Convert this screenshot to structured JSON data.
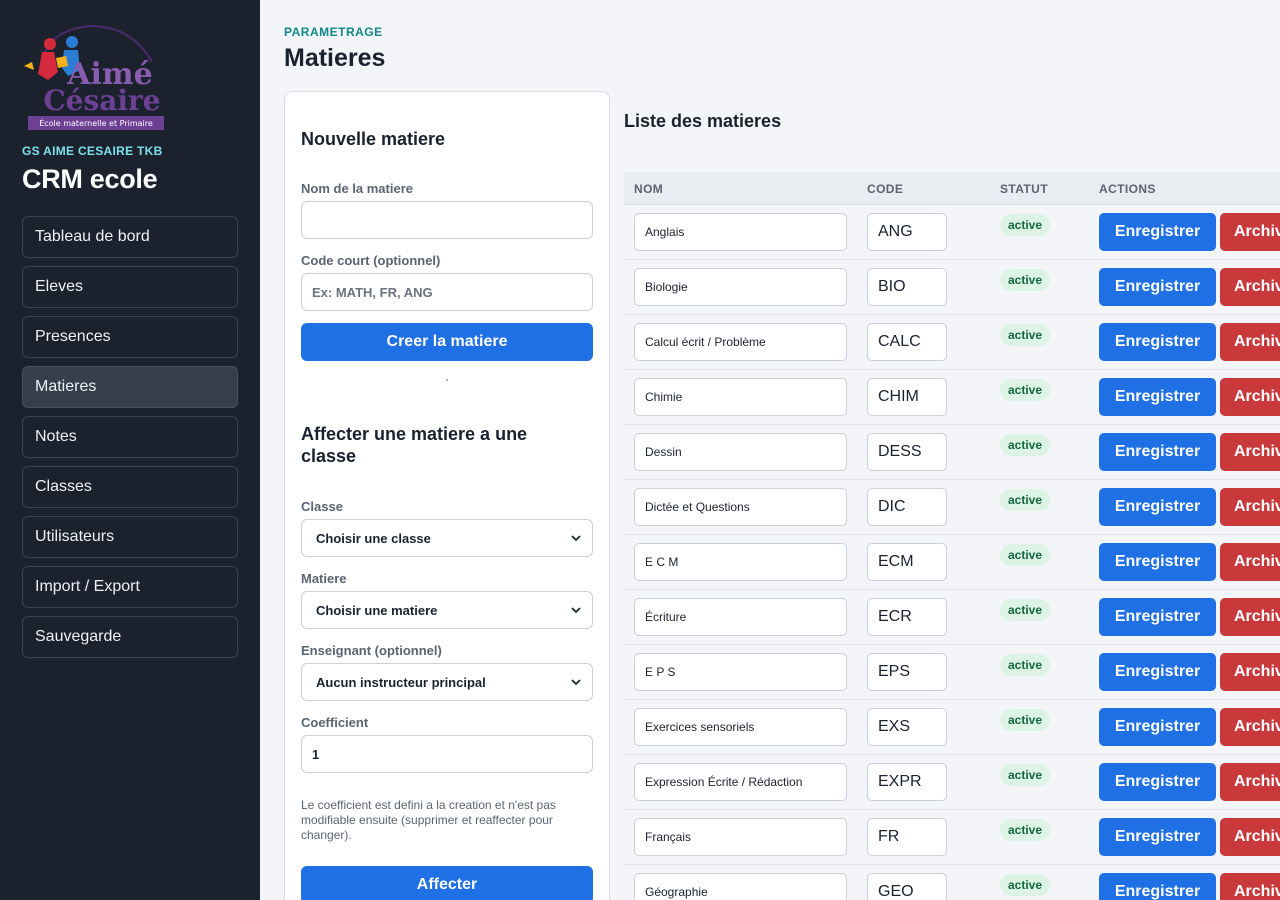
{
  "sidebar": {
    "logo_text": "Aimé Césaire",
    "logo_subtitle": "École maternelle et Primaire",
    "org": "GS AIME CESAIRE TKB",
    "app_title": "CRM ecole",
    "items": [
      {
        "label": "Tableau de bord",
        "active": false
      },
      {
        "label": "Eleves",
        "active": false
      },
      {
        "label": "Presences",
        "active": false
      },
      {
        "label": "Matieres",
        "active": true
      },
      {
        "label": "Notes",
        "active": false
      },
      {
        "label": "Classes",
        "active": false
      },
      {
        "label": "Utilisateurs",
        "active": false
      },
      {
        "label": "Import / Export",
        "active": false
      },
      {
        "label": "Sauvegarde",
        "active": false
      }
    ]
  },
  "header": {
    "eyebrow": "PARAMETRAGE",
    "title": "Matieres"
  },
  "create_form": {
    "title": "Nouvelle matiere",
    "name_label": "Nom de la matiere",
    "name_value": "",
    "code_label": "Code court (optionnel)",
    "code_placeholder": "Ex: MATH, FR, ANG",
    "submit_label": "Creer la matiere"
  },
  "assign_form": {
    "title": "Affecter une matiere a une classe",
    "class_label": "Classe",
    "class_value": "Choisir une classe",
    "subject_label": "Matiere",
    "subject_value": "Choisir une matiere",
    "teacher_label": "Enseignant (optionnel)",
    "teacher_value": "Aucun instructeur principal",
    "coef_label": "Coefficient",
    "coef_value": "1",
    "hint": "Le coefficient est defini a la creation et n'est pas modifiable ensuite (supprimer et reaffecter pour changer).",
    "submit_label": "Affecter"
  },
  "list": {
    "title": "Liste des matieres",
    "columns": {
      "name": "NOM",
      "code": "CODE",
      "status": "STATUT",
      "actions": "ACTIONS"
    },
    "save_label": "Enregistrer",
    "archive_label": "Archiver",
    "rows": [
      {
        "name": "Anglais",
        "code": "ANG",
        "status": "active"
      },
      {
        "name": "Biologie",
        "code": "BIO",
        "status": "active"
      },
      {
        "name": "Calcul écrit / Problème",
        "code": "CALC",
        "status": "active"
      },
      {
        "name": "Chimie",
        "code": "CHIM",
        "status": "active"
      },
      {
        "name": "Dessin",
        "code": "DESS",
        "status": "active"
      },
      {
        "name": "Dictée et Questions",
        "code": "DIC",
        "status": "active"
      },
      {
        "name": "E C M",
        "code": "ECM",
        "status": "active"
      },
      {
        "name": "Écriture",
        "code": "ECR",
        "status": "active"
      },
      {
        "name": "E P S",
        "code": "EPS",
        "status": "active"
      },
      {
        "name": "Exercices sensoriels",
        "code": "EXS",
        "status": "active"
      },
      {
        "name": "Expression Écrite / Rédaction",
        "code": "EXPR",
        "status": "active"
      },
      {
        "name": "Français",
        "code": "FR",
        "status": "active"
      },
      {
        "name": "Géographie",
        "code": "GEO",
        "status": "active"
      }
    ]
  },
  "colors": {
    "sidebar_bg": "#1b222d",
    "primary": "#1f6fe5",
    "danger": "#c9393c",
    "accent": "#0f8a8a",
    "badge_bg": "#dcf3e6"
  }
}
